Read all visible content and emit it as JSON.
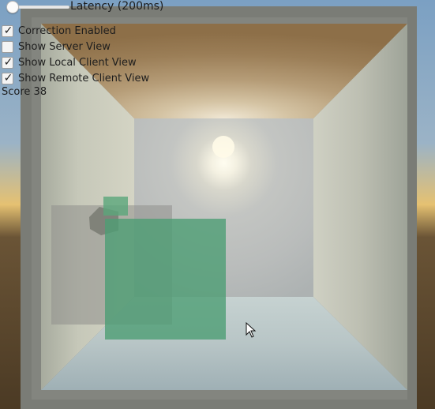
{
  "latency": {
    "label": "Latency (200ms)",
    "slider_fraction": 0.1
  },
  "checkboxes": [
    {
      "label": "Correction Enabled",
      "checked": true
    },
    {
      "label": "Show Server View",
      "checked": false
    },
    {
      "label": "Show Local Client View",
      "checked": true
    },
    {
      "label": "Show Remote Client View",
      "checked": true
    }
  ],
  "score": {
    "label": "Score 38"
  },
  "check_glyph": "✓",
  "icons": {
    "cursor": "mouse-pointer-icon"
  },
  "colors": {
    "frame": "#7a7c76",
    "cube_local": "#4e9e74",
    "cube_remote": "#8f8f8c",
    "light": "#fffbe8",
    "floor": "#b5c3c3",
    "ceiling": "#a88c66"
  }
}
